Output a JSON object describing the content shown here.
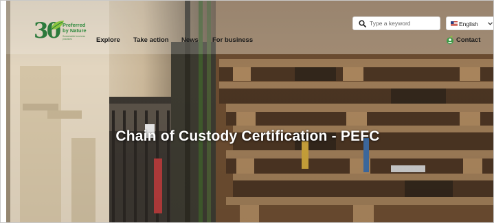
{
  "brand": {
    "anniversary": "30",
    "name_line1": "Preferred",
    "name_line2": "by Nature",
    "tagline": "Sustainable business practices"
  },
  "nav": {
    "items": [
      {
        "label": "Explore"
      },
      {
        "label": "Take action"
      },
      {
        "label": "News"
      },
      {
        "label": "For business"
      }
    ]
  },
  "search": {
    "placeholder": "Type a keyword",
    "value": "",
    "icon": "search-icon"
  },
  "language": {
    "selected": "English",
    "flag_icon": "us-flag-icon",
    "chevron_icon": "chevron-down-icon"
  },
  "contact": {
    "label": "Contact",
    "icon": "contact-icon"
  },
  "hero": {
    "title": "Chain of Custody Certification - PEFC"
  },
  "colors": {
    "brand_green": "#2c7a3c",
    "nav_text": "#1c1c1c",
    "title_text": "#ffffff"
  }
}
